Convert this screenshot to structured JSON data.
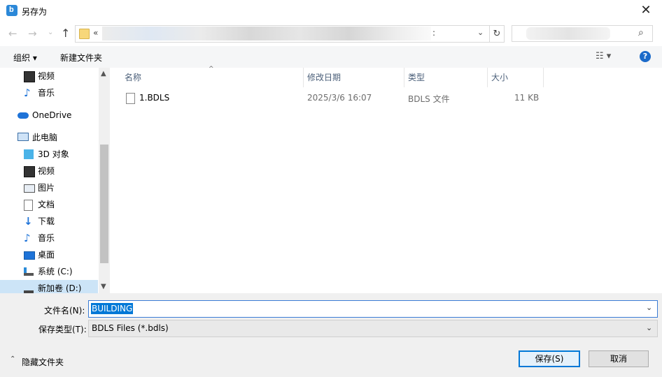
{
  "window": {
    "title": "另存为",
    "close": "✕"
  },
  "nav": {
    "back": "←",
    "forward": "→",
    "recent": "⌄",
    "up": "↑"
  },
  "address": {
    "chevrons": "«",
    "tail": ":",
    "dropdown": "⌄",
    "refresh": "↻"
  },
  "search": {
    "icon": "⌕"
  },
  "toolbar": {
    "organize": "组织 ▾",
    "new_folder": "新建文件夹",
    "view": "☷ ▾",
    "help": "?"
  },
  "sidebar": {
    "items": [
      {
        "label": "视频",
        "icon": "video-icon"
      },
      {
        "label": "音乐",
        "icon": "music-icon"
      },
      {
        "label": "OneDrive",
        "icon": "cloud-icon"
      },
      {
        "label": "此电脑",
        "icon": "computer-icon"
      },
      {
        "label": "3D 对象",
        "icon": "cube-icon"
      },
      {
        "label": "视频",
        "icon": "video-icon"
      },
      {
        "label": "图片",
        "icon": "picture-icon"
      },
      {
        "label": "文档",
        "icon": "document-icon"
      },
      {
        "label": "下载",
        "icon": "download-icon"
      },
      {
        "label": "音乐",
        "icon": "music-icon"
      },
      {
        "label": "桌面",
        "icon": "desktop-icon"
      },
      {
        "label": "系统 (C:)",
        "icon": "drive-icon"
      },
      {
        "label": "新加卷 (D:)",
        "icon": "drive-icon"
      }
    ],
    "scroll_up": "▲",
    "scroll_down": "▼"
  },
  "columns": {
    "name": "名称",
    "modified": "修改日期",
    "type": "类型",
    "size": "大小",
    "sort": "^"
  },
  "files": [
    {
      "name": "1.BDLS",
      "modified": "2025/3/6 16:07",
      "type": "BDLS 文件",
      "size": "11 KB"
    }
  ],
  "form": {
    "filename_label": "文件名(N):",
    "filename_value": "BUILDING",
    "savetype_label": "保存类型(T):",
    "savetype_value": "BDLS Files  (*.bdls)",
    "dropdown": "⌄"
  },
  "footer": {
    "hide_folders": "隐藏文件夹",
    "hide_chevron": "⌃",
    "save": "保存(S)",
    "cancel": "取消"
  },
  "colors": {
    "accent": "#0078d7",
    "selection": "#cce4f7",
    "header_text": "#4c607a"
  }
}
